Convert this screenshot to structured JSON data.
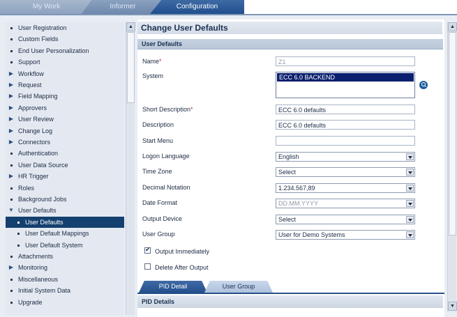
{
  "tabs": [
    {
      "label": "My Work"
    },
    {
      "label": "Informer"
    },
    {
      "label": "Configuration",
      "active": true
    }
  ],
  "sidebar": {
    "items": [
      {
        "label": "User Registration",
        "marker": "bullet"
      },
      {
        "label": "Custom Fields",
        "marker": "bullet"
      },
      {
        "label": "End User Personalization",
        "marker": "bullet"
      },
      {
        "label": "Support",
        "marker": "bullet"
      },
      {
        "label": "Workflow",
        "marker": "collapsed"
      },
      {
        "label": "Request",
        "marker": "collapsed"
      },
      {
        "label": "Field Mapping",
        "marker": "collapsed"
      },
      {
        "label": "Approvers",
        "marker": "collapsed"
      },
      {
        "label": "User Review",
        "marker": "collapsed"
      },
      {
        "label": "Change Log",
        "marker": "collapsed"
      },
      {
        "label": "Connectors",
        "marker": "collapsed"
      },
      {
        "label": "Authentication",
        "marker": "bullet"
      },
      {
        "label": "User Data Source",
        "marker": "bullet"
      },
      {
        "label": "HR Trigger",
        "marker": "collapsed"
      },
      {
        "label": "Roles",
        "marker": "bullet"
      },
      {
        "label": "Background Jobs",
        "marker": "bullet"
      },
      {
        "label": "User Defaults",
        "marker": "expanded"
      },
      {
        "label": "User Defaults",
        "marker": "bullet",
        "level": 2,
        "active": true
      },
      {
        "label": "User Default Mappings",
        "marker": "bullet",
        "level": 2
      },
      {
        "label": "User Default System",
        "marker": "bullet",
        "level": 2
      },
      {
        "label": "Attachments",
        "marker": "bullet"
      },
      {
        "label": "Monitoring",
        "marker": "collapsed"
      },
      {
        "label": "Miscellaneous",
        "marker": "bullet"
      },
      {
        "label": "Initial System Data",
        "marker": "bullet"
      },
      {
        "label": "Upgrade",
        "marker": "bullet"
      }
    ]
  },
  "main": {
    "title": "Change User Defaults",
    "section": "User Defaults",
    "fields": {
      "name": {
        "label": "Name",
        "required": "*",
        "value": "Z1"
      },
      "system": {
        "label": "System",
        "options": [
          "ECC 6.0 BACKEND"
        ]
      },
      "short_description": {
        "label": "Short Description",
        "required": "*",
        "value": "ECC 6.0 defaults"
      },
      "description": {
        "label": "Description",
        "value": "ECC 6.0 defaults"
      },
      "start_menu": {
        "label": "Start Menu",
        "value": ""
      },
      "logon_language": {
        "label": "Logon Language",
        "value": "English"
      },
      "time_zone": {
        "label": "Time Zone",
        "value": "Select"
      },
      "decimal_notation": {
        "label": "Decimal Notation",
        "value": "1.234.567,89"
      },
      "date_format": {
        "label": "Date Format",
        "value": "DD.MM.YYYY"
      },
      "output_device": {
        "label": "Output Device",
        "value": "Select"
      },
      "user_group": {
        "label": "User Group",
        "value": "User for Demo Systems"
      }
    },
    "checkboxes": {
      "output_immediately": {
        "label": "Output Immediately",
        "checked": true
      },
      "delete_after_output": {
        "label": "Delete After Output",
        "checked": false
      }
    },
    "subtabs": [
      {
        "label": "PID Detail",
        "active": true
      },
      {
        "label": "User Group"
      }
    ],
    "pid_section": "PID Details"
  },
  "icons": {
    "scroll_up": "▲",
    "scroll_down": "▼",
    "tree_collapsed": "▶",
    "tree_expanded": "▼",
    "search": "search-icon"
  },
  "colors": {
    "active_tab": "#2a5795",
    "sidebar_selected": "#14406f",
    "listbox_selected": "#0a1f6e",
    "required_star": "#c0392b"
  }
}
